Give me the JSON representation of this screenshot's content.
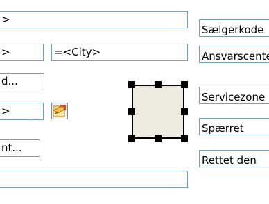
{
  "fields": {
    "row1_value": ">",
    "row2_left_value": ">",
    "row2_city_value": "=<City>",
    "row3_value": "d...",
    "row4_value": ">",
    "row5_value": "nt...",
    "row6_value": ""
  },
  "labels": {
    "salesperson_code": "Sælgerkode",
    "responsibility_center": "Ansvarscenter",
    "service_zone": "Servicezone",
    "blocked": "Spærret",
    "corrected_date": "Rettet den"
  },
  "icons": {
    "lookup_button": "edit-lookup-icon",
    "selected_shape": "selected-rectangle-shape"
  }
}
